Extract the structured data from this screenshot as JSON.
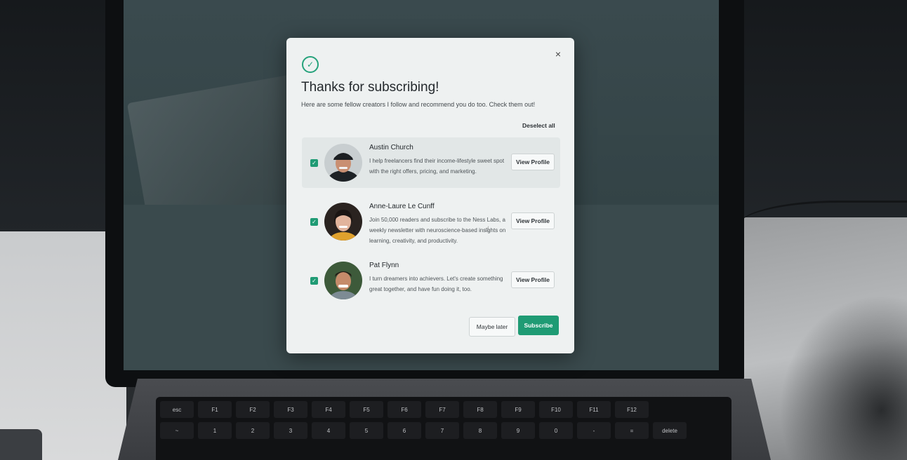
{
  "modal": {
    "title": "Thanks for subscribing!",
    "subtitle": "Here are some fellow creators I follow and recommend you do too. Check them out!",
    "deselect_all": "Deselect all",
    "close_icon": "×",
    "check_icon": "✓",
    "creators": [
      {
        "name": "Austin Church",
        "description": "I help freelancers find their income-lifestyle sweet spot with the right offers, pricing, and marketing.",
        "view_profile": "View Profile",
        "checked": true
      },
      {
        "name": "Anne-Laure Le Cunff",
        "description": "Join 50,000 readers and subscribe to the Ness Labs, a weekly newsletter with neuroscience-based insights on learning, creativity, and productivity.",
        "view_profile": "View Profile",
        "checked": true
      },
      {
        "name": "Pat Flynn",
        "description": "I turn dreamers into achievers. Let's create something great together, and have fun doing it, too.",
        "view_profile": "View Profile",
        "checked": true
      }
    ],
    "maybe_later": "Maybe later",
    "subscribe": "Subscribe"
  },
  "keyboard": {
    "fn_row": [
      "esc",
      "F1",
      "F2",
      "F3",
      "F4",
      "F5",
      "F6",
      "F7",
      "F8",
      "F9",
      "F10",
      "F11",
      "F12"
    ],
    "num_row": [
      "~",
      "1",
      "2",
      "3",
      "4",
      "5",
      "6",
      "7",
      "8",
      "9",
      "0",
      "-",
      "=",
      "delete"
    ]
  },
  "colors": {
    "accent": "#1f9b74",
    "modal_bg": "#eef1f1",
    "text": "#24292d"
  }
}
